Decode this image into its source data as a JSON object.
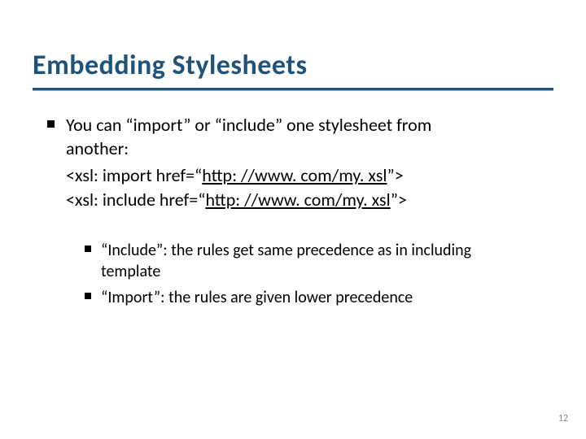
{
  "title": "Embedding Stylesheets",
  "bullet1_line1": "You can “import” or “include” one stylesheet from",
  "bullet1_line2": "another:",
  "code1_pre": "<xsl: import href=“",
  "code1_link": "http: //www. com/my. xsl",
  "code1_post": "”>",
  "code2_pre": "<xsl: include href=“",
  "code2_link": "http: //www. com/my. xsl",
  "code2_post": "”>",
  "bullet2_line1": "“Include”: the rules get same precedence as in including",
  "bullet2_line2": "template",
  "bullet3": "“Import”: the rules are given lower precedence",
  "page_number": "12"
}
